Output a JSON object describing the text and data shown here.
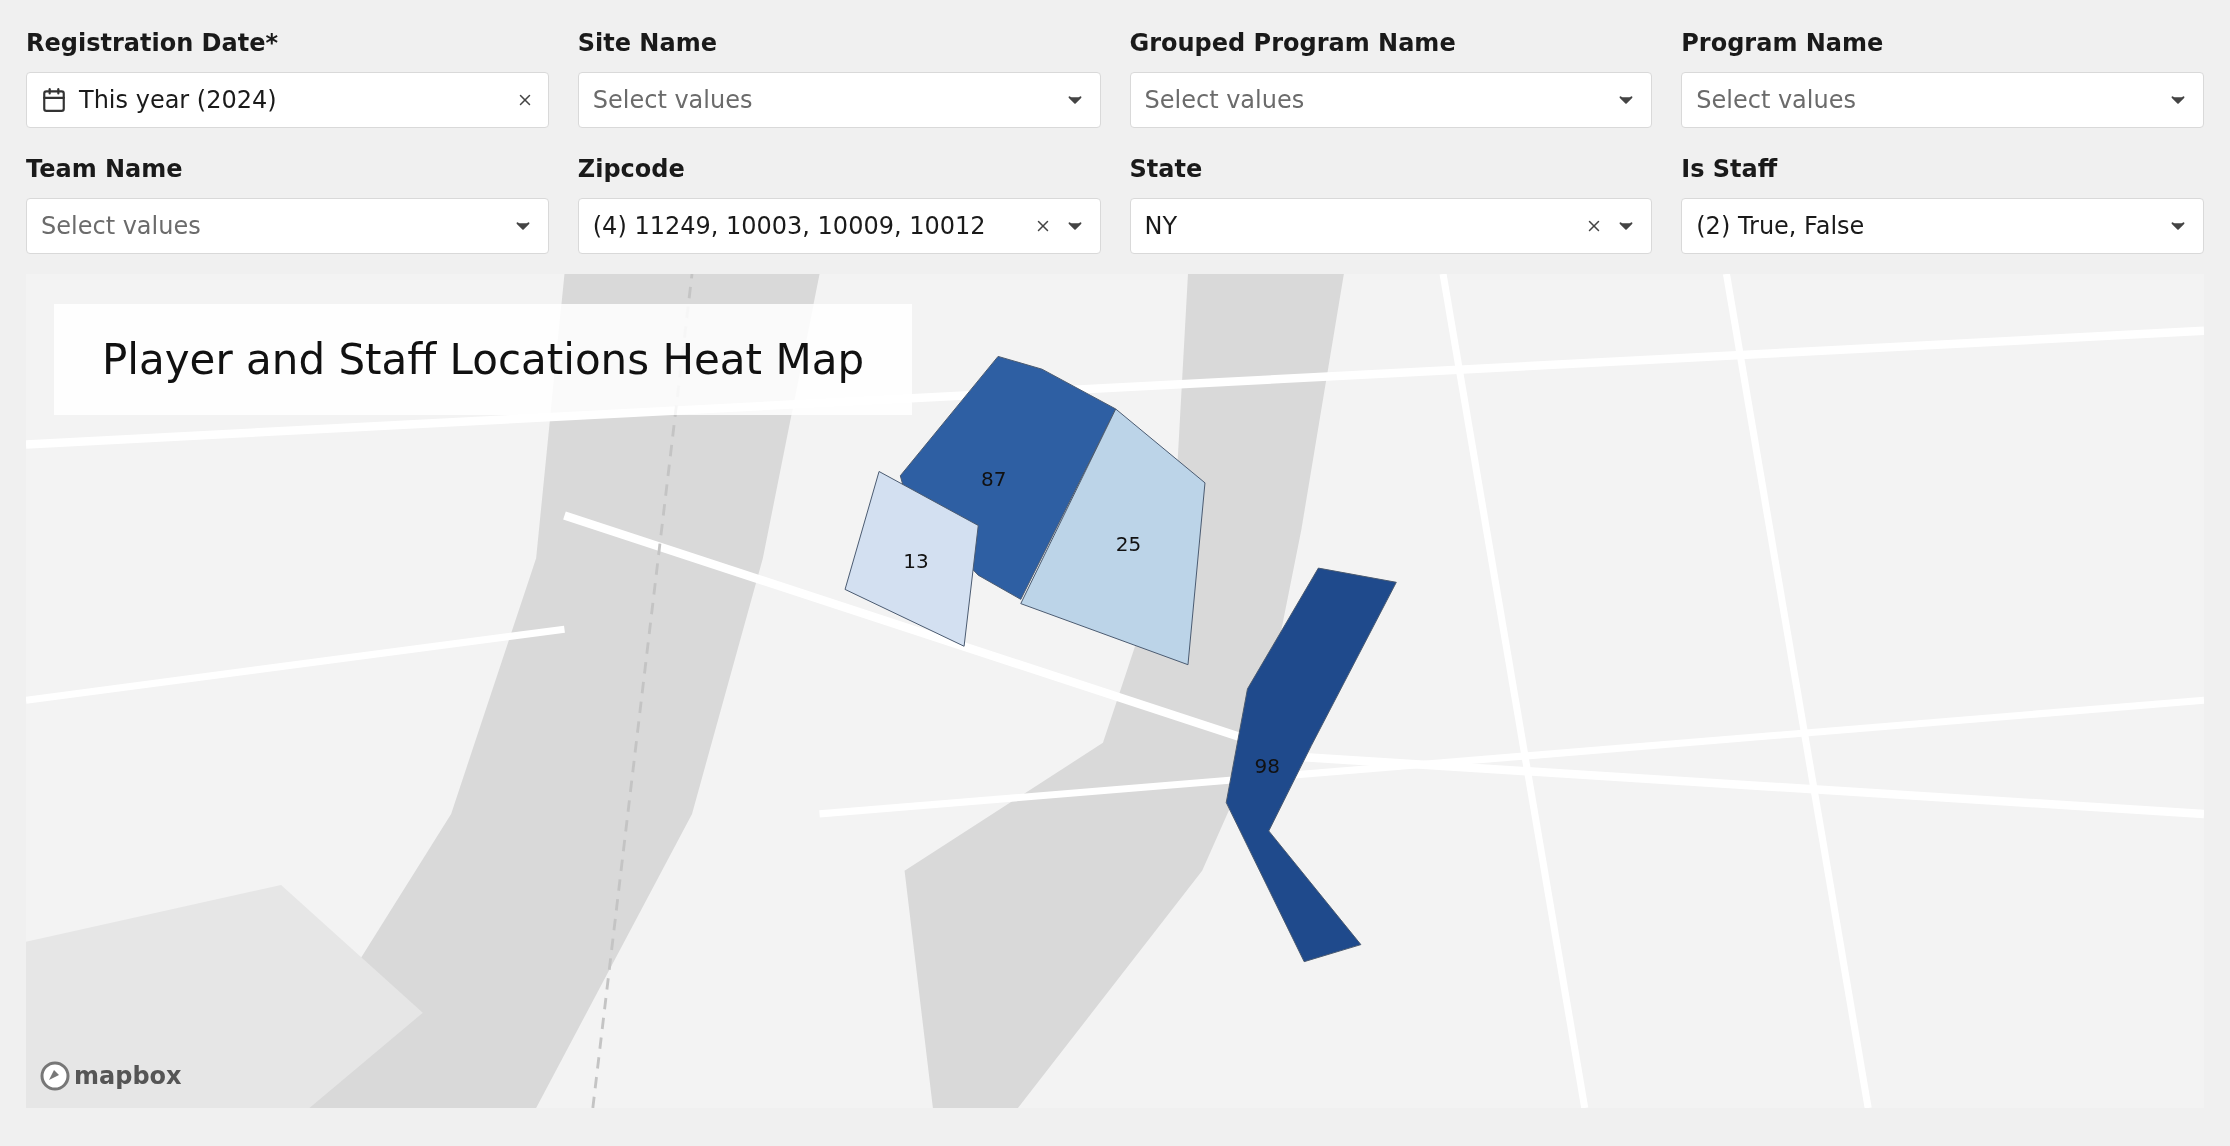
{
  "filters": [
    {
      "label": "Registration Date*",
      "kind": "date",
      "value": "This year (2024)",
      "clearable": true
    },
    {
      "label": "Site Name",
      "kind": "select",
      "placeholder": "Select values",
      "clearable": false
    },
    {
      "label": "Grouped Program Name",
      "kind": "select",
      "placeholder": "Select values",
      "clearable": false
    },
    {
      "label": "Program Name",
      "kind": "select",
      "placeholder": "Select values",
      "clearable": false
    },
    {
      "label": "Team Name",
      "kind": "select",
      "placeholder": "Select values",
      "clearable": false
    },
    {
      "label": "Zipcode",
      "kind": "select",
      "value": "(4) 11249, 10003, 10009, 10012",
      "clearable": true
    },
    {
      "label": "State",
      "kind": "select",
      "value": "NY",
      "clearable": true
    },
    {
      "label": "Is Staff",
      "kind": "select",
      "value": "(2) True, False",
      "clearable": false
    }
  ],
  "map": {
    "title": "Player and Staff Locations Heat Map",
    "attribution": "mapbox",
    "regions": [
      {
        "value": "87",
        "color": "#2e5fa3"
      },
      {
        "value": "25",
        "color": "#bcd4e8"
      },
      {
        "value": "13",
        "color": "#d3e0f1"
      },
      {
        "value": "98",
        "color": "#1f4a8c"
      }
    ]
  }
}
